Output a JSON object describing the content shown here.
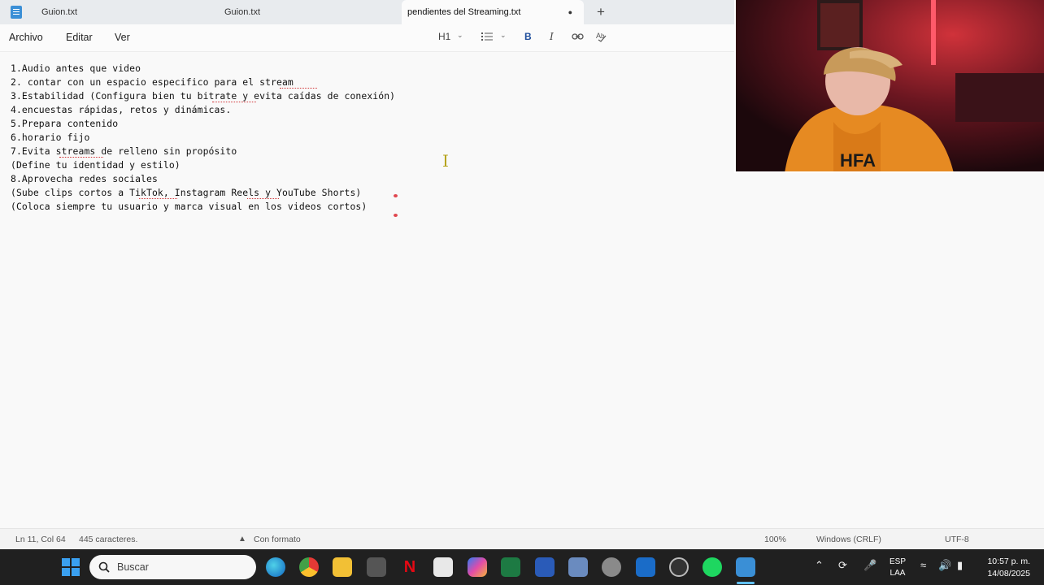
{
  "tabs": [
    {
      "label": "Guion.txt"
    },
    {
      "label": "Guion.txt"
    },
    {
      "label": "pendientes del Streaming.txt",
      "close": "●"
    }
  ],
  "tab_add": "+",
  "menu": {
    "archivo": "Archivo",
    "editar": "Editar",
    "ver": "Ver",
    "heading": "H1",
    "bold": "B",
    "italic": "I"
  },
  "document": {
    "lines": [
      "1.Audio antes que video",
      "2. contar con un espacio especifico para el stream",
      "3.Estabilidad (Configura bien tu bitrate y evita caídas de conexión)",
      "4.encuestas rápidas, retos y dinámicas.",
      "5.Prepara contenido",
      "6.horario fijo",
      "7.Evita streams de relleno sin propósito",
      "(Define tu identidad y estilo)",
      "8.Aprovecha redes sociales",
      "(Sube clips cortos a TikTok, Instagram Reels y YouTube Shorts)",
      "(Coloca siempre tu usuario y marca visual en los videos cortos)"
    ]
  },
  "status": {
    "position": "Ln 11, Col 64",
    "chars": "445 caracteres.",
    "format": "Con formato",
    "zoom": "100%",
    "line_ending": "Windows (CRLF)",
    "encoding": "UTF-8"
  },
  "taskbar": {
    "search_placeholder": "Buscar",
    "lang_top": "ESP",
    "lang_bottom": "LAA",
    "time": "10:57 p. m.",
    "date": "14/08/2025"
  },
  "colors": {
    "accent": "#3aa0f0",
    "spellcheck": "#d13438",
    "taskbar": "#202020"
  }
}
